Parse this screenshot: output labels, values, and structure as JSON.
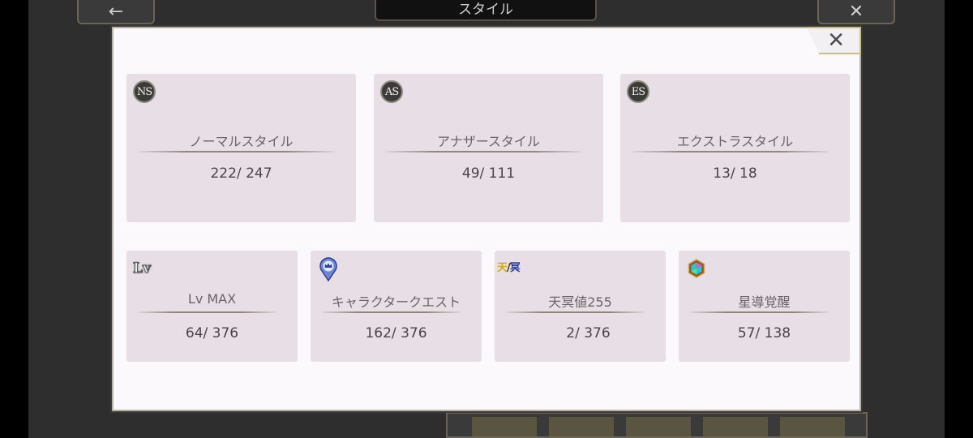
{
  "screen": {
    "title": "スタイル",
    "back_glyph": "←",
    "close_glyph": "✕"
  },
  "modal": {
    "close_glyph": "✕",
    "top_cards": [
      {
        "badge": "NS",
        "label": "ノーマルスタイル",
        "count": "222/ 247"
      },
      {
        "badge": "AS",
        "label": "アナザースタイル",
        "count": "49/ 111"
      },
      {
        "badge": "ES",
        "label": "エクストラスタイル",
        "count": "13/ 18"
      }
    ],
    "bottom_cards": [
      {
        "icon_text": "Lv",
        "icon": "lv-icon",
        "label": "Lv MAX",
        "count": "64/ 376"
      },
      {
        "icon": "crown-pin-icon",
        "label": "キャラクタークエスト",
        "count": "162/ 376"
      },
      {
        "icon_text_a": "天",
        "icon_sep": "/",
        "icon_text_b": "冥",
        "icon": "tenmei-icon",
        "label": "天冥値255",
        "count": "2/ 376"
      },
      {
        "icon": "star-awakening-icon",
        "label": "星導覚醒",
        "count": "57/ 138"
      }
    ]
  },
  "colors": {
    "card_bg": "#e7dfe5",
    "modal_bg": "#fbf9fb",
    "modal_border": "#b8b3a6",
    "label_text": "#6b6467",
    "count_text": "#4a4447"
  }
}
